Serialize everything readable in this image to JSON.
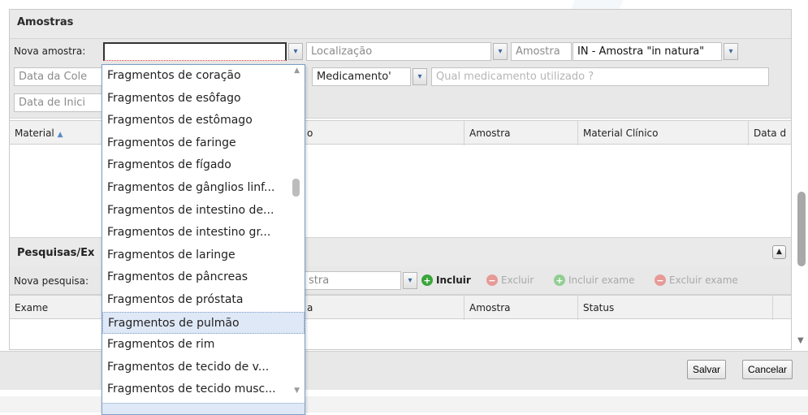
{
  "samples_panel": {
    "title": "Amostras",
    "new_sample_label": "Nova amostra:",
    "new_sample_value": "",
    "location_placeholder": "Localização",
    "sample_placeholder": "Amostra",
    "sample_type_value": "IN - Amostra \"in natura\"",
    "collection_date_placeholder": "Data da Cole",
    "medication_value": "Medicamento'",
    "medication_question_placeholder": "Qual medicamento utilizado ?",
    "start_date_placeholder": "Data de Inici",
    "columns": [
      "Material",
      "o",
      "Amostra",
      "Material Clínico",
      "Data d"
    ]
  },
  "research_panel": {
    "title": "Pesquisas/Ex",
    "new_research_label": "Nova pesquisa:",
    "research_field_value": "stra",
    "include_label": "Incluir",
    "exclude_label": "Excluir",
    "include_exam_label": "Incluir exame",
    "exclude_exam_label": "Excluir exame",
    "columns": [
      "Exame",
      "a",
      "Amostra",
      "Status"
    ]
  },
  "dropdown": {
    "items": [
      "Fragmentos de coração",
      "Fragmentos de esôfago",
      "Fragmentos de estômago",
      "Fragmentos de faringe",
      "Fragmentos de fígado",
      "Fragmentos de gânglios linf...",
      "Fragmentos de intestino de...",
      "Fragmentos de intestino gr...",
      "Fragmentos de laringe",
      "Fragmentos de pâncreas",
      "Fragmentos de próstata",
      "Fragmentos de pulmão",
      "Fragmentos de rim",
      "Fragmentos de tecido de v...",
      "Fragmentos de tecido musc..."
    ],
    "selected_index": 11
  },
  "footer": {
    "save_label": "Salvar",
    "cancel_label": "Cancelar"
  },
  "colors": {
    "accent": "#3b6aa0",
    "add_green": "#3aa53a",
    "remove_red": "#d9534f"
  }
}
